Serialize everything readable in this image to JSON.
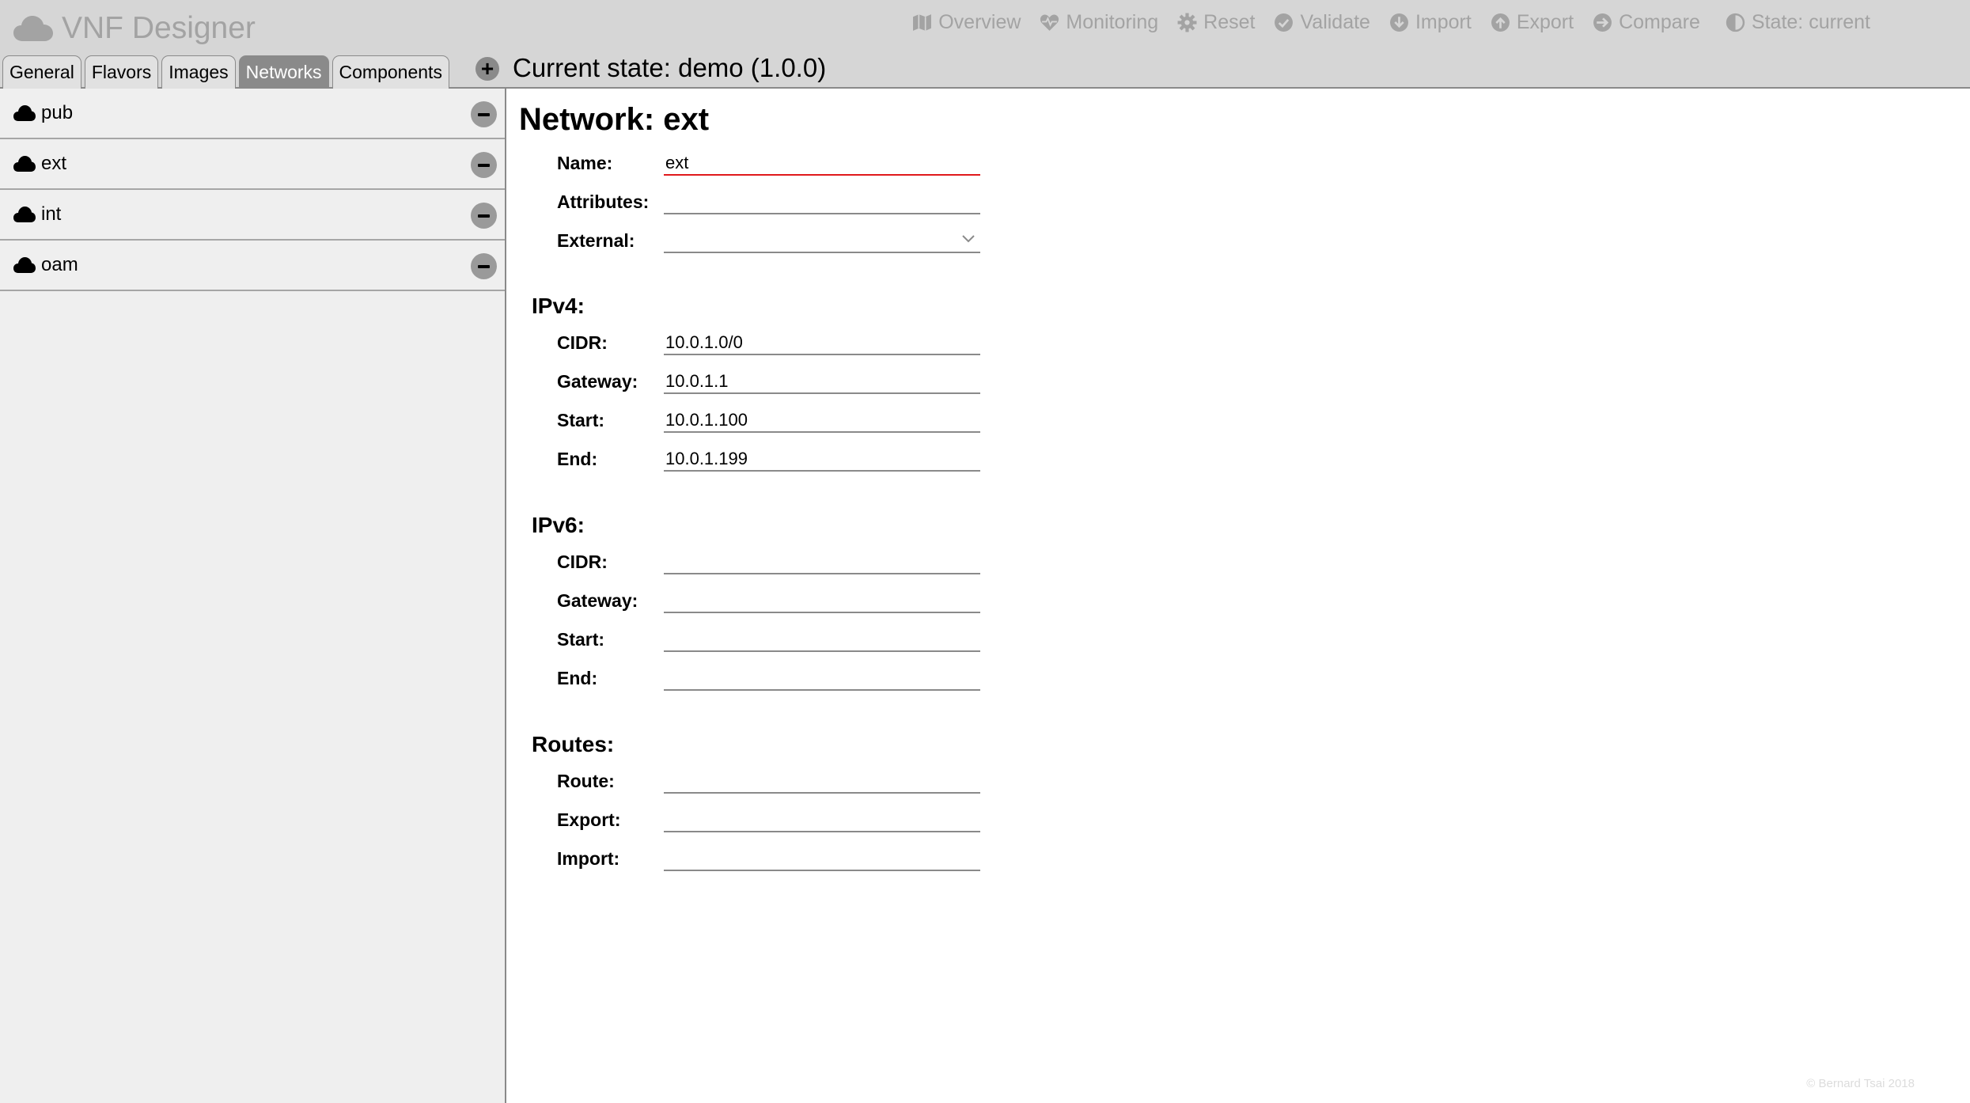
{
  "app": {
    "title": "VNF Designer",
    "logo_icon": "cloud-icon"
  },
  "menu": [
    {
      "label": "Overview",
      "icon": "map-icon"
    },
    {
      "label": "Monitoring",
      "icon": "heartbeat-icon"
    },
    {
      "label": "Reset",
      "icon": "gear-icon"
    },
    {
      "label": "Validate",
      "icon": "check-circle-icon"
    },
    {
      "label": "Import",
      "icon": "download-icon"
    },
    {
      "label": "Export",
      "icon": "upload-icon"
    },
    {
      "label": "Compare",
      "icon": "compare-icon"
    },
    {
      "label": "State: current",
      "icon": "half-circle-icon"
    }
  ],
  "tabs": [
    {
      "label": "General",
      "active": false
    },
    {
      "label": "Flavors",
      "active": false
    },
    {
      "label": "Images",
      "active": false
    },
    {
      "label": "Networks",
      "active": true
    },
    {
      "label": "Components",
      "active": false
    }
  ],
  "add_button_label": "+",
  "current_state": "Current state: demo (1.0.0)",
  "networks": [
    {
      "name": "pub"
    },
    {
      "name": "ext"
    },
    {
      "name": "int"
    },
    {
      "name": "oam"
    }
  ],
  "detail": {
    "title": "Network: ext",
    "name_label": "Name:",
    "name_value": "ext",
    "attributes_label": "Attributes:",
    "attributes_value": "",
    "external_label": "External:",
    "external_value": "",
    "ipv4": {
      "heading": "IPv4:",
      "cidr_label": "CIDR:",
      "cidr_value": "10.0.1.0/0",
      "gateway_label": "Gateway:",
      "gateway_value": "10.0.1.1",
      "start_label": "Start:",
      "start_value": "10.0.1.100",
      "end_label": "End:",
      "end_value": "10.0.1.199"
    },
    "ipv6": {
      "heading": "IPv6:",
      "cidr_label": "CIDR:",
      "cidr_value": "",
      "gateway_label": "Gateway:",
      "gateway_value": "",
      "start_label": "Start:",
      "start_value": "",
      "end_label": "End:",
      "end_value": ""
    },
    "routes": {
      "heading": "Routes:",
      "route_label": "Route:",
      "route_value": "",
      "export_label": "Export:",
      "export_value": "",
      "import_label": "Import:",
      "import_value": ""
    }
  },
  "footer": "© Bernard Tsai 2018",
  "colors": {
    "topbar": "#d6d6d6",
    "muted_text": "#a3a3a3",
    "active_tab": "#8a8a8a",
    "sidebar": "#efefef",
    "error_underline": "#e0191c"
  }
}
